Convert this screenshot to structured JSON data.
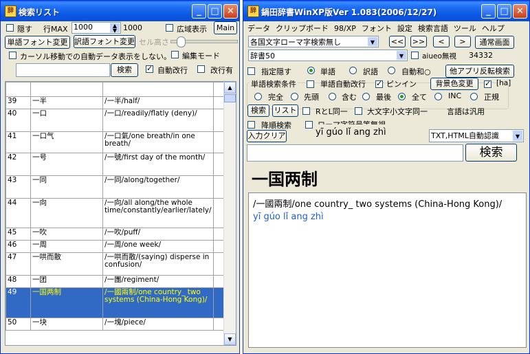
{
  "left_window": {
    "title": "検索リスト",
    "hide_label": "隠す",
    "row_max_label": "行MAX",
    "row_max_value": "1000",
    "row_max_total": "1000",
    "wide_display_label": "広域表示",
    "main_button": "Main",
    "word_font_button": "単語フォント変更",
    "trans_font_button": "訳語フォント変更",
    "cell_height_label": "セル高さ",
    "cursor_auto_label": "カーソル移動での自動データ表示をしない。",
    "edit_mode_label": "編集モード",
    "search_button": "検索",
    "auto_wrap_label": "自動改行",
    "wrap_label": "改行有",
    "rows": [
      {
        "num": "39",
        "word": "一半",
        "def": "/一半/half/"
      },
      {
        "num": "40",
        "word": "一口",
        "def": "/一口/readily/flatly (deny)/"
      },
      {
        "num": "41",
        "word": "一口气",
        "def": "/一口氣/one breath/in one breath/"
      },
      {
        "num": "42",
        "word": "一号",
        "def": "/一號/first day of the month/"
      },
      {
        "num": "43",
        "word": "一同",
        "def": "/一同/along/together/"
      },
      {
        "num": "44",
        "word": "一向",
        "def": "/一向/all along/the whole time/constantly/earlier/lately/"
      },
      {
        "num": "45",
        "word": "一吹",
        "def": "/一吹/puff/"
      },
      {
        "num": "46",
        "word": "一周",
        "def": "/一周/one week/"
      },
      {
        "num": "47",
        "word": "一哄而散",
        "def": "/一哄而散/(saying) disperse in confusion/"
      },
      {
        "num": "48",
        "word": "一团",
        "def": "/一團/regiment/"
      },
      {
        "num": "49",
        "word": "一国两制",
        "def": "/一國兩制/one country_ two systems (China-Hong Kong)/"
      },
      {
        "num": "50",
        "word": "一块",
        "def": "/一塊/piece/"
      }
    ]
  },
  "right_window": {
    "title": "鍋田辞書WinXP版Ver 1.083(2006/12/27)",
    "menu": [
      "データ",
      "クリップボード",
      "98/XP",
      "フォント",
      "設定",
      "検索言語",
      "ツール",
      "ヘルプ"
    ],
    "search_mode": "各国文字ローマ字検索無し",
    "nav_first": "<<",
    "nav_last": ">>",
    "nav_prev": "<",
    "nav_next": ">",
    "normal_screen_button": "通常画面",
    "dictionary": "辞書50",
    "aiueo_label": "aiueo無視",
    "count": "34332",
    "specify_hide_label": "指定隠す",
    "radio_word": "単語",
    "radio_trans": "訳語",
    "radio_auto": "自動和○",
    "other_app_button": "他アプリ反転検索",
    "group_label": "単語検索条件",
    "word_auto_wrap": "単語自動改行",
    "pinyin_label": "ピンイン",
    "bg_color_button": "背景色変更",
    "ha_label": "[ha]",
    "match_full": "完全",
    "match_prefix": "先頭",
    "match_contains": "含む",
    "match_suffix": "最後",
    "match_all": "全て",
    "match_inc": "INC",
    "match_regex": "正規",
    "search_btn": "検索",
    "list_btn": "リスト",
    "rl_same": "RとL同一",
    "case_same": "大文字小文字同一",
    "language_note": "言語は汎用",
    "descending": "降順検索",
    "roman_note": "ローマ字符号等無視",
    "input_clear": "入力クリア",
    "pinyin_display": "yī gúo lǐ ang zhì",
    "txt_html": "TXT,HTML自動認識",
    "search_big": "検索",
    "headword": "一国两制",
    "definition": "/一國兩制/one country_ two systems (China-Hong Kong)/",
    "definition_pinyin": "yī gúo lǐ ang zhì"
  },
  "colors": {
    "selection": "#316ac5",
    "selection_highlight": "#ffff00",
    "pinyin_blue": "#1e5fd6",
    "window_bg": "#ece9d8",
    "titlebar_blue": "#0b57e3"
  }
}
